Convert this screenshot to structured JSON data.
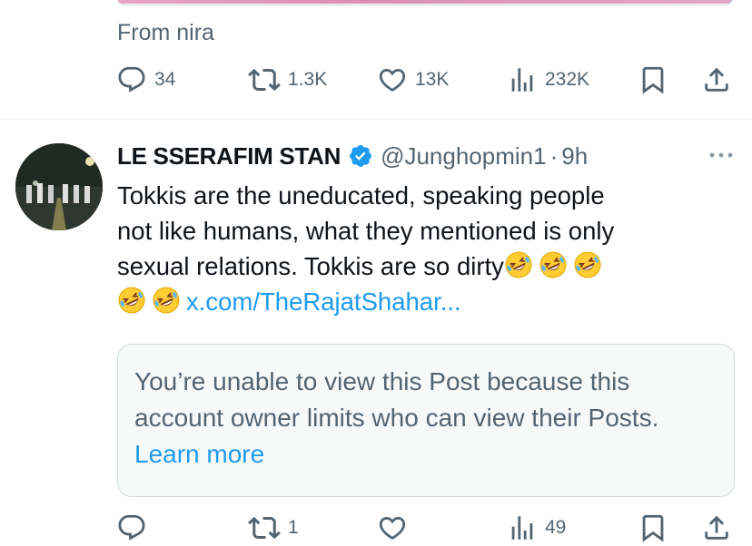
{
  "prev_post": {
    "from_text": "From nira",
    "actions": {
      "reply_count": "34",
      "repost_count": "1.3K",
      "like_count": "13K",
      "view_count": "232K"
    }
  },
  "post": {
    "display_name": "LE SSERAFIM STAN",
    "verified_icon": "verified-badge-icon",
    "handle": "@Junghopmin1",
    "separator": "·",
    "time": "9h",
    "text": {
      "line1": "Tokkis are the uneducated, speaking people",
      "line2": "not like humans, what they mentioned is only",
      "line3": "sexual relations. Tokkis are so dirty",
      "emoji_name": "rolling-on-the-floor-laughing-emoji",
      "link": "x.com/TheRajatShahar..."
    },
    "unavailable": {
      "message": "You’re unable to view this Post because this account owner limits who can view their Posts.",
      "learn_more": "Learn more"
    },
    "actions": {
      "reply_count": "",
      "repost_count": "1",
      "like_count": "",
      "view_count": "49"
    }
  },
  "colors": {
    "text_primary": "#0f1419",
    "text_secondary": "#536471",
    "link": "#1d9bf0",
    "verified": "#1d9bf0",
    "border": "#cfd9de"
  }
}
